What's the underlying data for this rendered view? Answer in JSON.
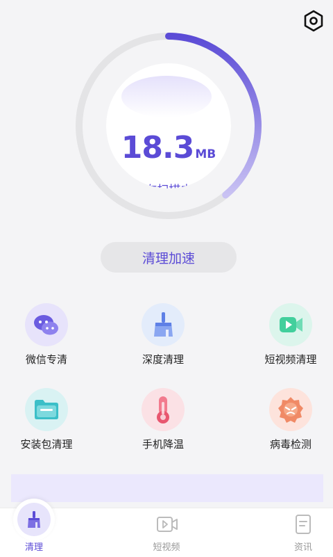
{
  "gauge": {
    "value": "18.3",
    "unit": "MB",
    "status": "正在扫描中...",
    "progress": 0.39
  },
  "speed_button": {
    "label": "清理加速"
  },
  "features": [
    {
      "label": "微信专清",
      "icon": "wechat-icon"
    },
    {
      "label": "深度清理",
      "icon": "broom-icon"
    },
    {
      "label": "短视频清理",
      "icon": "video-icon"
    },
    {
      "label": "安装包清理",
      "icon": "folder-icon"
    },
    {
      "label": "手机降温",
      "icon": "thermometer-icon"
    },
    {
      "label": "病毒检测",
      "icon": "virus-icon"
    }
  ],
  "tabs": [
    {
      "label": "清理",
      "icon": "broom-icon",
      "active": true
    },
    {
      "label": "短视频",
      "icon": "video-icon",
      "active": false
    },
    {
      "label": "资讯",
      "icon": "document-icon",
      "active": false
    }
  ],
  "colors": {
    "accent": "#5b4bd6",
    "background": "#f4f4f6"
  }
}
